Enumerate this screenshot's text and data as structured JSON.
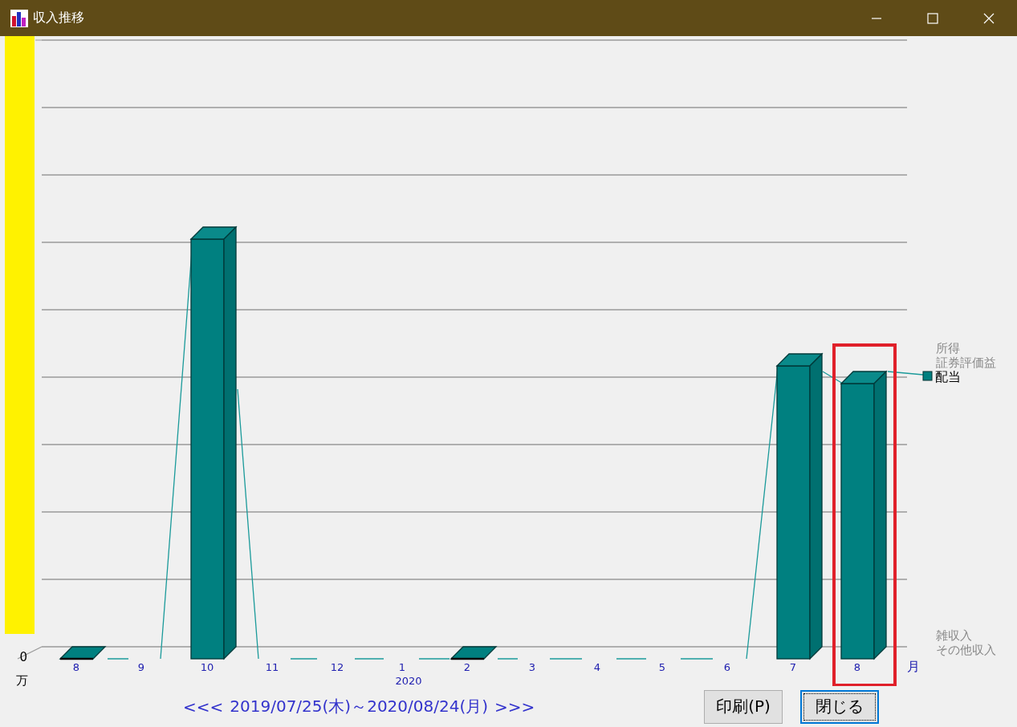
{
  "window": {
    "title": "収入推移"
  },
  "chart": {
    "y_axis": {
      "zero_label": "0",
      "unit": "万"
    },
    "x_axis": {
      "unit": "月",
      "labels": [
        {
          "month": "8"
        },
        {
          "month": "9"
        },
        {
          "month": "10"
        },
        {
          "month": "11"
        },
        {
          "month": "12"
        },
        {
          "month": "1",
          "year": "2020"
        },
        {
          "month": "2"
        },
        {
          "month": "3"
        },
        {
          "month": "4"
        },
        {
          "month": "5"
        },
        {
          "month": "6"
        },
        {
          "month": "7"
        },
        {
          "month": "8"
        }
      ]
    },
    "legend": [
      {
        "label": "所得",
        "active": false
      },
      {
        "label": "証券評価益",
        "active": false
      },
      {
        "label": "配当",
        "active": true
      },
      {
        "label": "雑収入",
        "active": false
      },
      {
        "label": "その他収入",
        "active": false
      }
    ]
  },
  "period": {
    "prev": "<<<",
    "range": "2019/07/25(木)～2020/08/24(月)",
    "next": ">>>"
  },
  "buttons": [
    {
      "label": "印刷(P)",
      "focused": false
    },
    {
      "label": "閉じる",
      "focused": true
    }
  ]
}
